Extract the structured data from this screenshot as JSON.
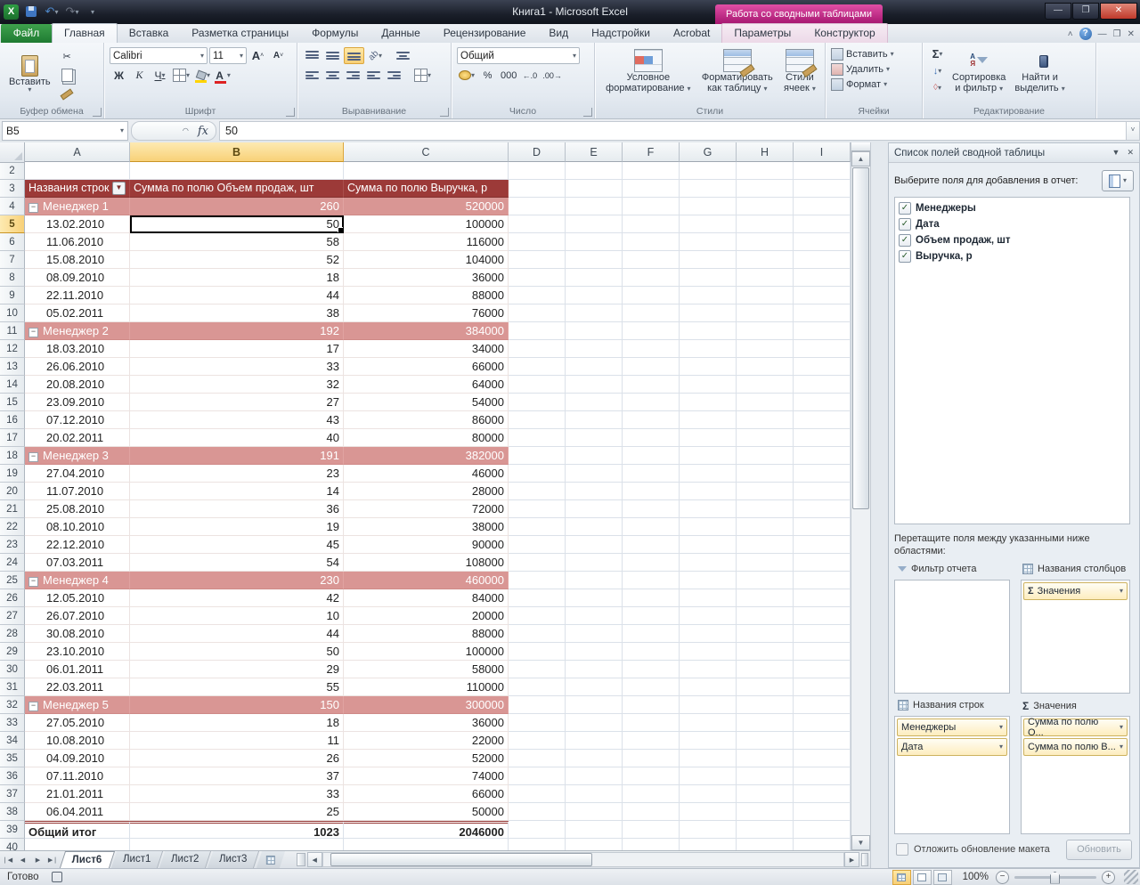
{
  "title_bar": {
    "title": "Книга1  -  Microsoft Excel",
    "contextual_label": "Работа со сводными таблицами"
  },
  "ribbon_tabs": {
    "file": "Файл",
    "main": [
      "Главная",
      "Вставка",
      "Разметка страницы",
      "Формулы",
      "Данные",
      "Рецензирование",
      "Вид",
      "Надстройки",
      "Acrobat"
    ],
    "active": "Главная",
    "contextual": [
      "Параметры",
      "Конструктор"
    ]
  },
  "ribbon": {
    "clipboard": {
      "group_label": "Буфер обмена",
      "paste": "Вставить"
    },
    "font": {
      "group_label": "Шрифт",
      "name": "Calibri",
      "size": "11",
      "bold": "Ж",
      "italic": "К",
      "underline": "Ч",
      "grow": "A",
      "shrink": "A",
      "color_letter": "А"
    },
    "alignment": {
      "group_label": "Выравнивание"
    },
    "number": {
      "group_label": "Число",
      "format": "Общий",
      "percent": "%",
      "thousands": "000",
      "inc_dec": "←.0",
      "dec_dec": ".00→"
    },
    "styles": {
      "group_label": "Стили",
      "conditional_1": "Условное",
      "conditional_2": "форматирование",
      "table_1": "Форматировать",
      "table_2": "как таблицу",
      "cellstyles_1": "Стили",
      "cellstyles_2": "ячеек"
    },
    "cells": {
      "group_label": "Ячейки",
      "insert": "Вставить",
      "delete": "Удалить",
      "format": "Формат"
    },
    "editing": {
      "group_label": "Редактирование",
      "sum": "Σ",
      "az_top": "А",
      "az_bottom": "Я",
      "sort_1": "Сортировка",
      "sort_2": "и фильтр",
      "find_1": "Найти и",
      "find_2": "выделить"
    }
  },
  "formula_bar": {
    "cell_ref": "B5",
    "fx": "fx",
    "value": "50"
  },
  "grid": {
    "columns": [
      "A",
      "B",
      "C",
      "D",
      "E",
      "F",
      "G",
      "H",
      "I"
    ],
    "selected_column": "B",
    "selected_row": 5,
    "selected_cell": "B5",
    "rows": [
      {
        "n": 2,
        "type": "empty",
        "a": "",
        "b": "",
        "c": ""
      },
      {
        "n": 3,
        "type": "header",
        "a": "Названия строк",
        "b": "Сумма по полю Объем продаж, шт",
        "c": "Сумма по полю Выручка, р"
      },
      {
        "n": 4,
        "type": "manager",
        "a": "Менеджер 1",
        "b": "260",
        "c": "520000"
      },
      {
        "n": 5,
        "type": "data",
        "a": "13.02.2010",
        "b": "50",
        "c": "100000"
      },
      {
        "n": 6,
        "type": "data",
        "a": "11.06.2010",
        "b": "58",
        "c": "116000"
      },
      {
        "n": 7,
        "type": "data",
        "a": "15.08.2010",
        "b": "52",
        "c": "104000"
      },
      {
        "n": 8,
        "type": "data",
        "a": "08.09.2010",
        "b": "18",
        "c": "36000"
      },
      {
        "n": 9,
        "type": "data",
        "a": "22.11.2010",
        "b": "44",
        "c": "88000"
      },
      {
        "n": 10,
        "type": "data",
        "a": "05.02.2011",
        "b": "38",
        "c": "76000"
      },
      {
        "n": 11,
        "type": "manager",
        "a": "Менеджер 2",
        "b": "192",
        "c": "384000"
      },
      {
        "n": 12,
        "type": "data",
        "a": "18.03.2010",
        "b": "17",
        "c": "34000"
      },
      {
        "n": 13,
        "type": "data",
        "a": "26.06.2010",
        "b": "33",
        "c": "66000"
      },
      {
        "n": 14,
        "type": "data",
        "a": "20.08.2010",
        "b": "32",
        "c": "64000"
      },
      {
        "n": 15,
        "type": "data",
        "a": "23.09.2010",
        "b": "27",
        "c": "54000"
      },
      {
        "n": 16,
        "type": "data",
        "a": "07.12.2010",
        "b": "43",
        "c": "86000"
      },
      {
        "n": 17,
        "type": "data",
        "a": "20.02.2011",
        "b": "40",
        "c": "80000"
      },
      {
        "n": 18,
        "type": "manager",
        "a": "Менеджер 3",
        "b": "191",
        "c": "382000"
      },
      {
        "n": 19,
        "type": "data",
        "a": "27.04.2010",
        "b": "23",
        "c": "46000"
      },
      {
        "n": 20,
        "type": "data",
        "a": "11.07.2010",
        "b": "14",
        "c": "28000"
      },
      {
        "n": 21,
        "type": "data",
        "a": "25.08.2010",
        "b": "36",
        "c": "72000"
      },
      {
        "n": 22,
        "type": "data",
        "a": "08.10.2010",
        "b": "19",
        "c": "38000"
      },
      {
        "n": 23,
        "type": "data",
        "a": "22.12.2010",
        "b": "45",
        "c": "90000"
      },
      {
        "n": 24,
        "type": "data",
        "a": "07.03.2011",
        "b": "54",
        "c": "108000"
      },
      {
        "n": 25,
        "type": "manager",
        "a": "Менеджер 4",
        "b": "230",
        "c": "460000"
      },
      {
        "n": 26,
        "type": "data",
        "a": "12.05.2010",
        "b": "42",
        "c": "84000"
      },
      {
        "n": 27,
        "type": "data",
        "a": "26.07.2010",
        "b": "10",
        "c": "20000"
      },
      {
        "n": 28,
        "type": "data",
        "a": "30.08.2010",
        "b": "44",
        "c": "88000"
      },
      {
        "n": 29,
        "type": "data",
        "a": "23.10.2010",
        "b": "50",
        "c": "100000"
      },
      {
        "n": 30,
        "type": "data",
        "a": "06.01.2011",
        "b": "29",
        "c": "58000"
      },
      {
        "n": 31,
        "type": "data",
        "a": "22.03.2011",
        "b": "55",
        "c": "110000"
      },
      {
        "n": 32,
        "type": "manager",
        "a": "Менеджер 5",
        "b": "150",
        "c": "300000"
      },
      {
        "n": 33,
        "type": "data",
        "a": "27.05.2010",
        "b": "18",
        "c": "36000"
      },
      {
        "n": 34,
        "type": "data",
        "a": "10.08.2010",
        "b": "11",
        "c": "22000"
      },
      {
        "n": 35,
        "type": "data",
        "a": "04.09.2010",
        "b": "26",
        "c": "52000"
      },
      {
        "n": 36,
        "type": "data",
        "a": "07.11.2010",
        "b": "37",
        "c": "74000"
      },
      {
        "n": 37,
        "type": "data",
        "a": "21.01.2011",
        "b": "33",
        "c": "66000"
      },
      {
        "n": 38,
        "type": "data",
        "a": "06.04.2011",
        "b": "25",
        "c": "50000"
      },
      {
        "n": 39,
        "type": "total",
        "a": "Общий итог",
        "b": "1023",
        "c": "2046000"
      },
      {
        "n": 40,
        "type": "empty",
        "a": "",
        "b": "",
        "c": ""
      }
    ]
  },
  "field_list": {
    "title": "Список полей сводной таблицы",
    "choose_label": "Выберите поля для добавления в отчет:",
    "fields": [
      "Менеджеры",
      "Дата",
      "Объем продаж, шт",
      "Выручка, р"
    ],
    "drag_label": "Перетащите поля между указанными ниже областями:",
    "filter_label": "Фильтр отчета",
    "columns_label": "Названия столбцов",
    "rows_label": "Названия строк",
    "values_label": "Значения",
    "columns_items": [
      "Значения"
    ],
    "rows_items": [
      "Менеджеры",
      "Дата"
    ],
    "values_items": [
      "Сумма по полю О...",
      "Сумма по полю В..."
    ],
    "defer_label": "Отложить обновление макета",
    "update_label": "Обновить"
  },
  "sheet_bar": {
    "tabs": [
      "Лист6",
      "Лист1",
      "Лист2",
      "Лист3"
    ],
    "active": "Лист6"
  },
  "status_bar": {
    "ready": "Готово",
    "zoom": "100%"
  },
  "colors": {
    "pivot_header": "#9c3a38",
    "pivot_subtotal": "#d99694",
    "selection_amber": "#f8d178",
    "file_tab_green": "#1e7a31",
    "contextual_magenta": "#a5156f"
  }
}
